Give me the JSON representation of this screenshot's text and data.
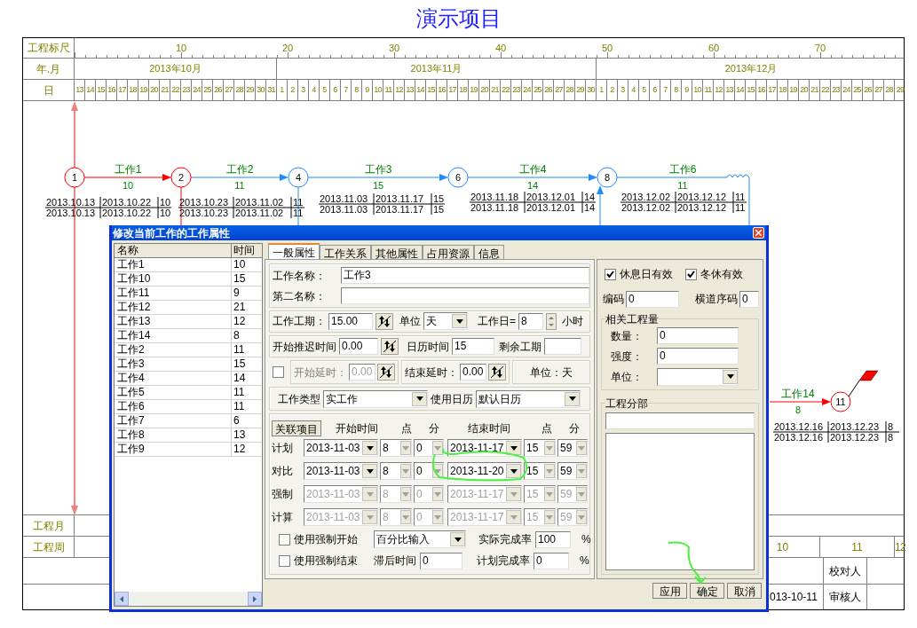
{
  "title": "演示项目",
  "ruler": {
    "label": "工程标尺",
    "ticks": [
      "10",
      "20",
      "30",
      "40",
      "50",
      "60",
      "70"
    ]
  },
  "months": {
    "label": "年.月",
    "items": [
      "2013年10月",
      "2013年11月",
      "2013年12月"
    ]
  },
  "days": {
    "label": "日",
    "items": [
      "13",
      "14",
      "15",
      "16",
      "17",
      "18",
      "19",
      "20",
      "21",
      "22",
      "23",
      "24",
      "25",
      "26",
      "27",
      "28",
      "29",
      "30",
      "31",
      "1",
      "2",
      "3",
      "4",
      "5",
      "6",
      "7",
      "8",
      "9",
      "10",
      "11",
      "12",
      "13",
      "14",
      "15",
      "16",
      "17",
      "18",
      "19",
      "20",
      "21",
      "22",
      "23",
      "24",
      "25",
      "26",
      "27",
      "28",
      "29",
      "30",
      "1",
      "2",
      "3",
      "4",
      "5",
      "6",
      "7",
      "8",
      "9",
      "10",
      "11",
      "12",
      "13",
      "14",
      "15",
      "16",
      "17",
      "18",
      "19",
      "20",
      "21",
      "22",
      "23",
      "24",
      "25",
      "26",
      "27",
      "28",
      "29"
    ]
  },
  "network": {
    "nodes": [
      {
        "label": "1",
        "critical": true
      },
      {
        "label": "2",
        "critical": true
      },
      {
        "label": "4",
        "critical": false
      },
      {
        "label": "6",
        "critical": false
      },
      {
        "label": "8",
        "critical": false
      },
      {
        "label": "11",
        "critical": true
      }
    ],
    "works": [
      {
        "name": "工作1",
        "duration": "10",
        "critical": true,
        "rows": [
          [
            "2013.10.13",
            "2013.10.22",
            "10"
          ],
          [
            "2013.10.13",
            "2013.10.22",
            "10"
          ]
        ]
      },
      {
        "name": "工作2",
        "duration": "11",
        "critical": false,
        "rows": [
          [
            "2013.10.23",
            "2013.11.02",
            "11"
          ],
          [
            "2013.10.23",
            "2013.11.02",
            "11"
          ]
        ]
      },
      {
        "name": "工作3",
        "duration": "15",
        "critical": false,
        "rows": [
          [
            "2013.11.03",
            "2013.11.17",
            "15"
          ],
          [
            "2013.11.03",
            "2013.11.17",
            "15"
          ]
        ]
      },
      {
        "name": "工作4",
        "duration": "14",
        "critical": false,
        "rows": [
          [
            "2013.11.18",
            "2013.12.01",
            "14"
          ],
          [
            "2013.11.18",
            "2013.12.01",
            "14"
          ]
        ]
      },
      {
        "name": "工作6",
        "duration": "11",
        "critical": false,
        "rows": [
          [
            "2013.12.02",
            "2013.12.12",
            "11"
          ],
          [
            "2013.12.02",
            "2013.12.12",
            "11"
          ]
        ]
      },
      {
        "name": "工作14",
        "duration": "8",
        "critical": true,
        "rows": [
          [
            "2013.12.16",
            "2013.12.23",
            "8"
          ],
          [
            "2013.12.16",
            "2013.12.23",
            "8"
          ]
        ]
      }
    ]
  },
  "month_row": {
    "label": "工程月"
  },
  "week_row": {
    "label": "工程周",
    "weeks": [
      "10",
      "11",
      "12"
    ]
  },
  "signoff": {
    "date": "013-10-11",
    "checker": "校对人",
    "reviewer": "审核人"
  },
  "dialog": {
    "title": "修改当前工作的工作属性",
    "list": {
      "columns": [
        "名称",
        "时间"
      ],
      "rows": [
        [
          "工作1",
          "10"
        ],
        [
          "工作10",
          "15"
        ],
        [
          "工作11",
          "9"
        ],
        [
          "工作12",
          "21"
        ],
        [
          "工作13",
          "12"
        ],
        [
          "工作14",
          "8"
        ],
        [
          "工作2",
          "11"
        ],
        [
          "工作3",
          "15"
        ],
        [
          "工作4",
          "14"
        ],
        [
          "工作5",
          "11"
        ],
        [
          "工作6",
          "11"
        ],
        [
          "工作7",
          "6"
        ],
        [
          "工作8",
          "13"
        ],
        [
          "工作9",
          "12"
        ]
      ]
    },
    "tabs": [
      {
        "label": "一般属性",
        "selected": true
      },
      {
        "label": "工作关系",
        "selected": false
      },
      {
        "label": "其他属性",
        "selected": false
      },
      {
        "label": "占用资源",
        "selected": false
      },
      {
        "label": "信息",
        "selected": false
      }
    ],
    "general": {
      "name": {
        "label": "工作名称：",
        "value": "工作3"
      },
      "second_name": {
        "label": "第二名称："
      },
      "duration": {
        "label": "工作工期：",
        "value": "15.00"
      },
      "unit": {
        "label": "单位",
        "value": "天"
      },
      "workday": {
        "label": "工作日=",
        "value": "8",
        "suffix": "小时"
      },
      "start_delay": {
        "label": "开始推迟时间",
        "value": "0.00"
      },
      "calendar_time": {
        "label": "日历时间",
        "value": "15"
      },
      "remaining": {
        "label": "剩余工期"
      },
      "start_lag": {
        "checked": false,
        "label": "开始延时：",
        "value": "0.00",
        "disabled": true
      },
      "end_lag": {
        "label": "结束延时：",
        "value": "0.00"
      },
      "unit_note": "单位：天",
      "work_type": {
        "label": "工作类型",
        "value": "实工作"
      },
      "calendar": {
        "label": "使用日历",
        "value": "默认日历"
      },
      "schedule": {
        "button": "关联项目",
        "headers": [
          "开始时间",
          "点",
          "分",
          "结束时间",
          "点",
          "分"
        ],
        "rows": [
          {
            "label": "计划",
            "disabled": false,
            "values": [
              "2013-11-03",
              "8",
              "0",
              "2013-11-17",
              "15",
              "59"
            ]
          },
          {
            "label": "对比",
            "disabled": false,
            "values": [
              "2013-11-03",
              "8",
              "0",
              "2013-11-20",
              "15",
              "59"
            ]
          },
          {
            "label": "强制",
            "disabled": true,
            "values": [
              "2013-11-03",
              "8",
              "0",
              "2013-11-17",
              "15",
              "59"
            ]
          },
          {
            "label": "计算",
            "disabled": true,
            "values": [
              "2013-11-03",
              "8",
              "0",
              "2013-11-17",
              "15",
              "59"
            ]
          }
        ]
      },
      "force_start": {
        "label": "使用强制开始",
        "checked": false
      },
      "force_end": {
        "label": "使用强制结束",
        "checked": false
      },
      "input_mode": {
        "value": "百分比输入"
      },
      "actual_rate": {
        "label": "实际完成率",
        "value": "100",
        "suffix": "%"
      },
      "lag": {
        "label": "滞后时间",
        "value": "0"
      },
      "planned_rate": {
        "label": "计划完成率",
        "value": "0",
        "suffix": "%"
      }
    },
    "side": {
      "rest_day": {
        "label": "休息日有效",
        "checked": true
      },
      "winter": {
        "label": "冬休有效",
        "checked": true
      },
      "code": {
        "label": "编码",
        "value": "0"
      },
      "lane": {
        "label": "横道序码",
        "value": "0"
      },
      "quantities": {
        "title": "相关工程量",
        "rows": [
          {
            "label": "数量：",
            "value": "0"
          },
          {
            "label": "强度：",
            "value": "0"
          }
        ],
        "unit": {
          "label": "单位："
        }
      },
      "division": {
        "title": "工程分部"
      }
    },
    "buttons": [
      "应用",
      "确定",
      "取消"
    ]
  }
}
